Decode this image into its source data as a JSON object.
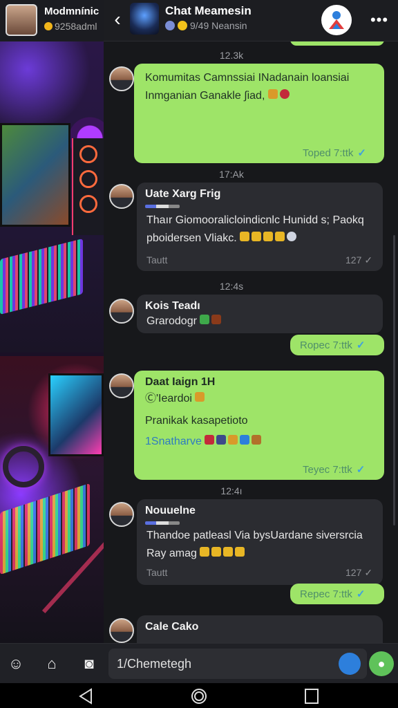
{
  "left_panel": {
    "name": "Modmnínic",
    "sub": "9258adml"
  },
  "header": {
    "title": "Chat Meamesin",
    "subtitle": "9/49 Neansin"
  },
  "messages": [
    {
      "kind": "out",
      "date": "12.3k",
      "text": "Komumitas Camnssiai INadanain loansiai Inmganian Ganakle ∫iad,",
      "time": "Toped  7:ttk"
    },
    {
      "kind": "in",
      "date": "17:Ak",
      "sender": "Uate Xarg Frig",
      "text": "Thaır Giomooralicloindicnlc Hunidd s; Paokq pboidersen Vliakc.",
      "footer": "Tautt",
      "time": "127"
    },
    {
      "kind": "in",
      "date": "12:4s",
      "sender": "Kois Teadı",
      "text": "Grarodogr",
      "time": ""
    },
    {
      "kind": "out",
      "text": "",
      "time": "Ropec  7:ttk"
    },
    {
      "kind": "out",
      "sender": "Daat Iaign 1H",
      "line2": "Ⓒ'Ieardoi",
      "text": "Pranikak kasapetioto",
      "line4": "1Snatharve",
      "time": "Teyec  7:ttk"
    },
    {
      "kind": "in",
      "date": "12:4ı",
      "sender": "Nouuelne",
      "text": "Thandoe patleasl Via bysUardane siversrcia Ray amag",
      "footer": "Tautt",
      "time": "127"
    },
    {
      "kind": "out",
      "text": "",
      "time": "Repec  7:ttk"
    },
    {
      "kind": "in",
      "sender": "Cale Cako",
      "text": "",
      "time": ""
    }
  ],
  "input": {
    "placeholder": "1/Chemetegh"
  },
  "icons": {
    "back": "chevron-left-icon",
    "more": "more-dots-icon",
    "attach": "camera-icon",
    "mic": "mic-icon"
  },
  "colors": {
    "out_bubble": "#9ee468",
    "in_bubble": "#2b2c31",
    "accent": "#3fa0e0"
  }
}
